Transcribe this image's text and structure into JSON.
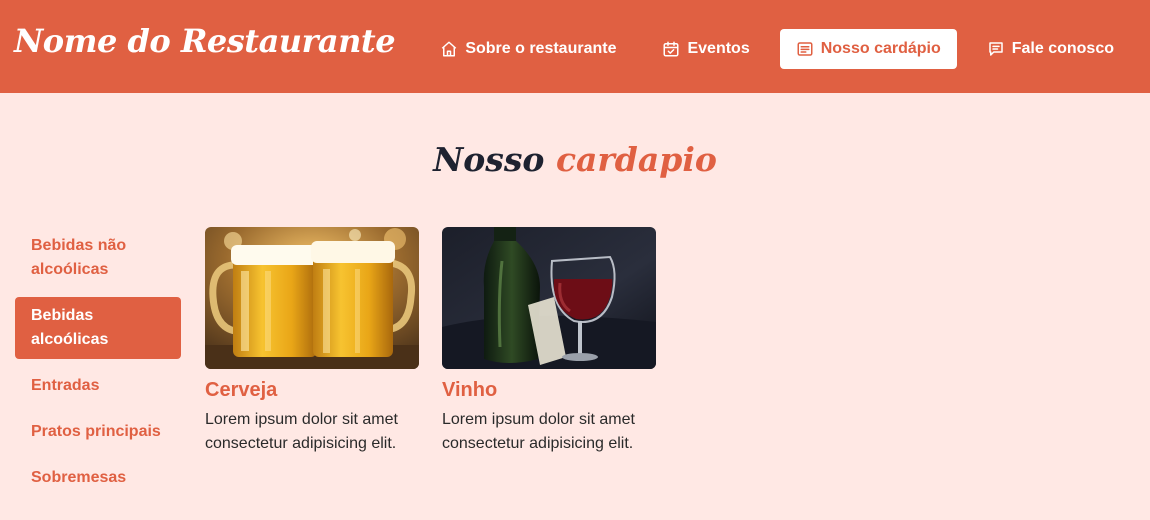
{
  "header": {
    "brand": "Nome do Restaurante",
    "background": "#e06042",
    "nav": [
      {
        "label": "Sobre o restaurante",
        "icon": "home-icon",
        "active": false
      },
      {
        "label": "Eventos",
        "icon": "calendar-check-icon",
        "active": false
      },
      {
        "label": "Nosso cardápio",
        "icon": "menu-list-icon",
        "active": true
      },
      {
        "label": "Fale conosco",
        "icon": "chat-icon",
        "active": false
      }
    ]
  },
  "section": {
    "title_part1": "Nosso",
    "title_part2": "cardapio"
  },
  "categories": [
    {
      "label": "Bebidas não alcoólicas",
      "active": false
    },
    {
      "label": "Bebidas alcoólicas",
      "active": true
    },
    {
      "label": "Entradas",
      "active": false
    },
    {
      "label": "Pratos principais",
      "active": false
    },
    {
      "label": "Sobremesas",
      "active": false
    }
  ],
  "items": [
    {
      "title": "Cerveja",
      "description": "Lorem ipsum dolor sit amet consectetur adipisicing elit.",
      "image": "beer-mugs-photo"
    },
    {
      "title": "Vinho",
      "description": "Lorem ipsum dolor sit amet consectetur adipisicing elit.",
      "image": "wine-bottle-glass-photo"
    }
  ],
  "colors": {
    "accent": "#e06042",
    "page_background": "#ffe8e4",
    "title_dark": "#1e2230"
  }
}
